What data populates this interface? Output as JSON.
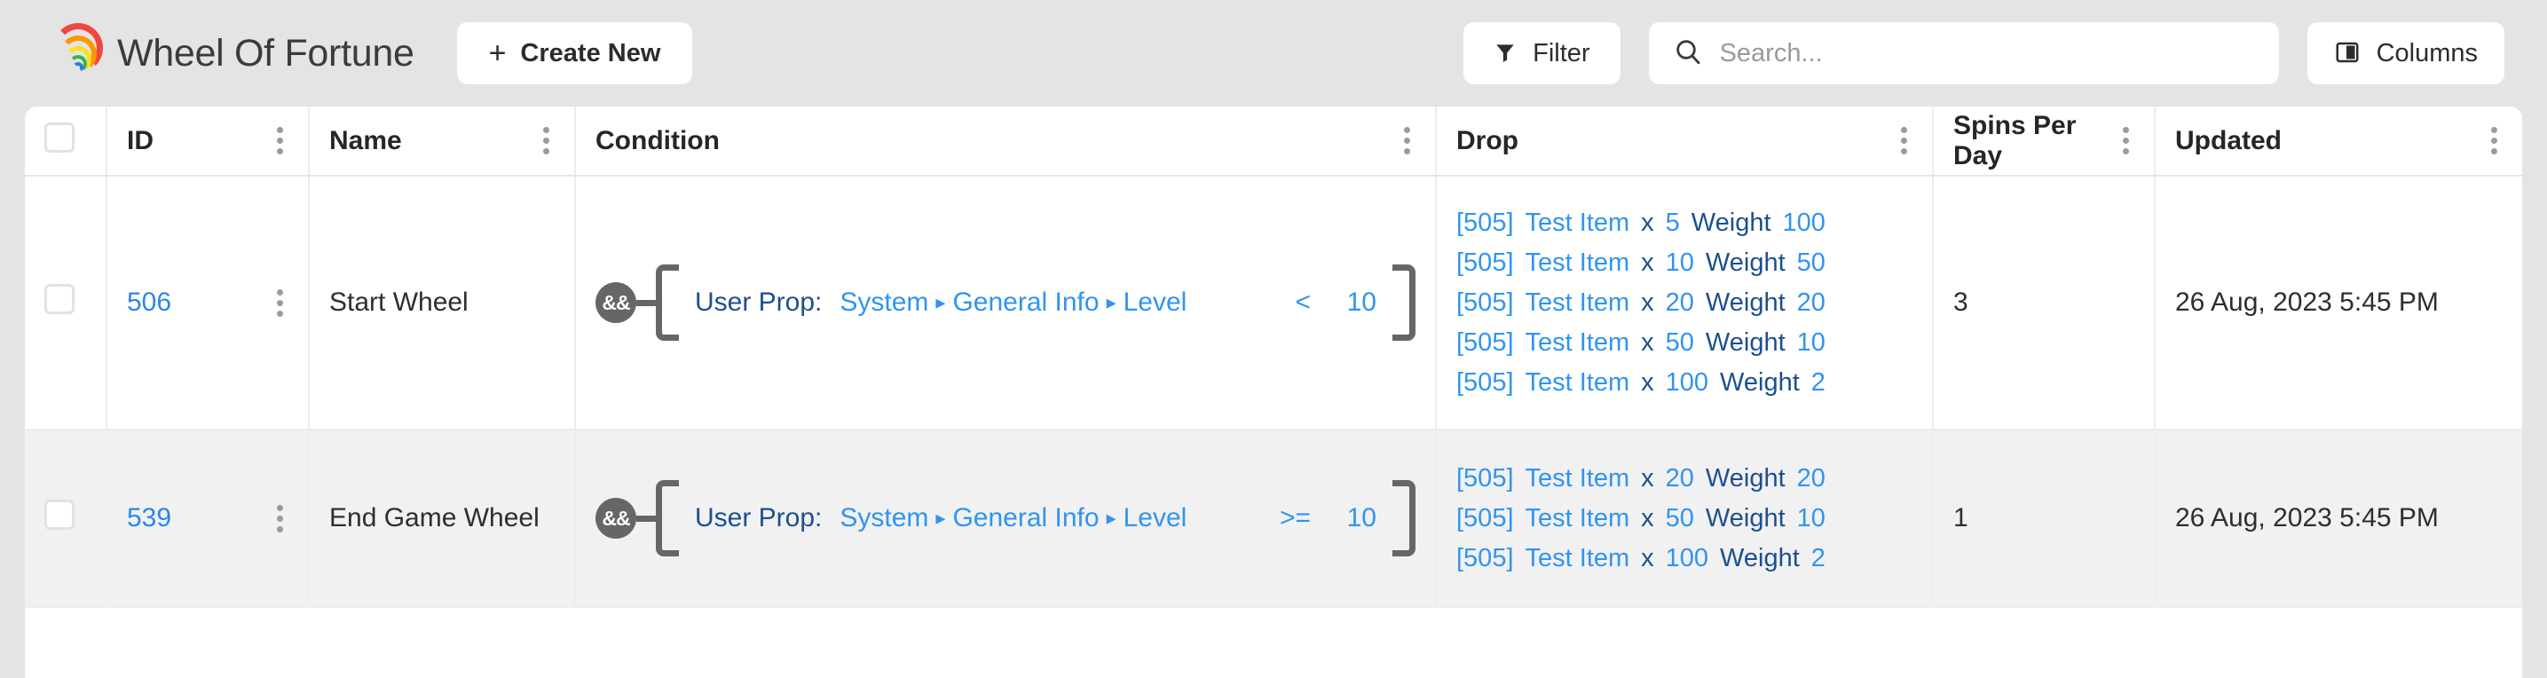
{
  "header": {
    "logo_icon": "rainbow-icon",
    "title": "Wheel Of Fortune",
    "create_new_label": "Create New",
    "create_new_plus": "+",
    "filter_label": "Filter",
    "filter_icon": "funnel-icon",
    "search_placeholder": "Search...",
    "search_value": "",
    "search_icon": "search-icon",
    "columns_label": "Columns",
    "columns_icon": "columns-icon"
  },
  "colors": {
    "page_background": "#e4e4e4",
    "row_alt_background": "#f1f1f1",
    "link_blue": "#2a87e8",
    "accent_blue": "#3094f0",
    "label_navy": "#1d4f91",
    "badge_gray": "#666666"
  },
  "table": {
    "columns": [
      {
        "key": "checkbox",
        "label": ""
      },
      {
        "key": "id",
        "label": "ID"
      },
      {
        "key": "name",
        "label": "Name"
      },
      {
        "key": "condition",
        "label": "Condition"
      },
      {
        "key": "drop",
        "label": "Drop"
      },
      {
        "key": "spins",
        "label": "Spins Per Day"
      },
      {
        "key": "updated",
        "label": "Updated"
      }
    ],
    "rows": [
      {
        "id": "506",
        "name": "Start Wheel",
        "condition": {
          "operator_badge": "&&",
          "label": "User Prop:",
          "path": [
            "System",
            "General Info",
            "Level"
          ],
          "separator": "▸",
          "comparison": "<",
          "value": "10"
        },
        "drops": [
          {
            "item_id": "[505]",
            "item_name": "Test Item",
            "x": "x",
            "quantity": "5",
            "weight_label": "Weight",
            "weight": "100"
          },
          {
            "item_id": "[505]",
            "item_name": "Test Item",
            "x": "x",
            "quantity": "10",
            "weight_label": "Weight",
            "weight": "50"
          },
          {
            "item_id": "[505]",
            "item_name": "Test Item",
            "x": "x",
            "quantity": "20",
            "weight_label": "Weight",
            "weight": "20"
          },
          {
            "item_id": "[505]",
            "item_name": "Test Item",
            "x": "x",
            "quantity": "50",
            "weight_label": "Weight",
            "weight": "10"
          },
          {
            "item_id": "[505]",
            "item_name": "Test Item",
            "x": "x",
            "quantity": "100",
            "weight_label": "Weight",
            "weight": "2"
          }
        ],
        "spins_per_day": "3",
        "updated": "26 Aug, 2023 5:45 PM"
      },
      {
        "id": "539",
        "name": "End Game Wheel",
        "condition": {
          "operator_badge": "&&",
          "label": "User Prop:",
          "path": [
            "System",
            "General Info",
            "Level"
          ],
          "separator": "▸",
          "comparison": ">=",
          "value": "10"
        },
        "drops": [
          {
            "item_id": "[505]",
            "item_name": "Test Item",
            "x": "x",
            "quantity": "20",
            "weight_label": "Weight",
            "weight": "20"
          },
          {
            "item_id": "[505]",
            "item_name": "Test Item",
            "x": "x",
            "quantity": "50",
            "weight_label": "Weight",
            "weight": "10"
          },
          {
            "item_id": "[505]",
            "item_name": "Test Item",
            "x": "x",
            "quantity": "100",
            "weight_label": "Weight",
            "weight": "2"
          }
        ],
        "spins_per_day": "1",
        "updated": "26 Aug, 2023 5:45 PM"
      }
    ]
  }
}
